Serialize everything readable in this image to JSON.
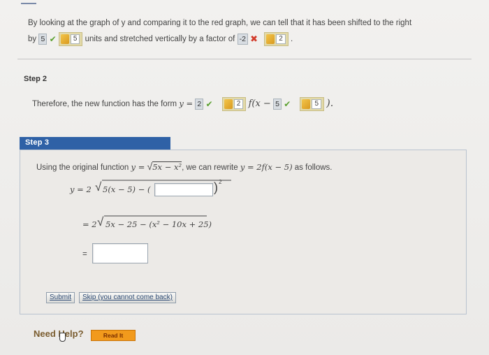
{
  "intro": {
    "sentence_part1": "By looking at the graph of y and comparing it to the red graph, we can tell that it has been shifted to the right",
    "by_label": "by",
    "shift_value": "5",
    "shift_hint_value": "5",
    "units_text": "units and stretched vertically by a factor of",
    "factor_value": "-2",
    "factor_hint_value": "2",
    "period": "."
  },
  "step2": {
    "label": "Step 2",
    "sentence": "Therefore, the new function has the form",
    "y_eq": "y =",
    "coef_value": "2",
    "coef_hint_value": "2",
    "f_open": "f(x −",
    "shift_value": "5",
    "shift_hint_value": "5",
    "close_paren": ")."
  },
  "step3": {
    "label": "Step 3",
    "sentence_part1": "Using the original function",
    "orig_func_lhs": "y =",
    "orig_func_radicand": "5x − x²",
    "sentence_part2": ", we can rewrite",
    "rewrite_expr": "y = 2f(x − 5)",
    "sentence_part3": "as follows.",
    "line1_lhs": "y = 2",
    "line1_radicand_start": "5(x − 5) − (",
    "line1_exponent": "2",
    "line2_lhs": "= 2",
    "line2_radicand": "5x − 25 − (x² − 10x + 25)",
    "line3_lhs": "=",
    "buttons": {
      "submit": "Submit",
      "skip": "Skip (you cannot come back)"
    }
  },
  "help": {
    "need_help": "Need Help?",
    "read_it": "Read It"
  },
  "colors": {
    "step_header_bg": "#2f61a6",
    "check": "#5aa030",
    "cross": "#d23b2b",
    "read_it_bg": "#f29a1c"
  }
}
